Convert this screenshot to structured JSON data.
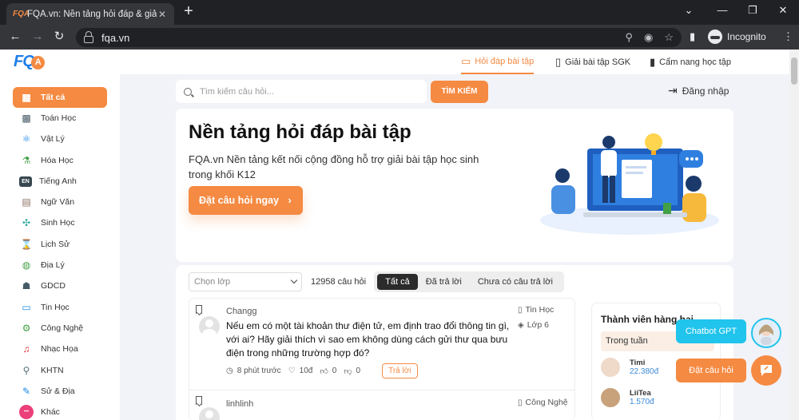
{
  "browser": {
    "tab_title": "FQA.vn: Nền tảng hỏi đáp & giải bà",
    "tab_favicon": "FQA",
    "url": "fqa.vn",
    "profile_label": "Incognito"
  },
  "site": {
    "logo_letters": "FQ",
    "logo_badge": "A",
    "nav": [
      {
        "label": "Hỏi đáp bài tập",
        "icon": "chat-icon"
      },
      {
        "label": "Giải bài tập SGK",
        "icon": "book-icon"
      },
      {
        "label": "Cẩm nang học tập",
        "icon": "notebook-icon"
      }
    ],
    "login_label": "Đăng nhập"
  },
  "sidebar": {
    "items": [
      {
        "label": "Tất cả",
        "icon": "grid-icon",
        "glyph": "▦"
      },
      {
        "label": "Toán Học",
        "icon": "calculator-icon",
        "glyph": "▩"
      },
      {
        "label": "Vật Lý",
        "icon": "atom-icon",
        "glyph": "⚛"
      },
      {
        "label": "Hóa Học",
        "icon": "flask-icon",
        "glyph": "⚗"
      },
      {
        "label": "Tiếng Anh",
        "icon": "en-icon",
        "glyph": "EN"
      },
      {
        "label": "Ngữ Văn",
        "icon": "book-icon",
        "glyph": "▤"
      },
      {
        "label": "Sinh Học",
        "icon": "dna-icon",
        "glyph": "✣"
      },
      {
        "label": "Lịch Sử",
        "icon": "hourglass-icon",
        "glyph": "⌛"
      },
      {
        "label": "Địa Lý",
        "icon": "globe-icon",
        "glyph": "◍"
      },
      {
        "label": "GDCD",
        "icon": "person-icon",
        "glyph": "☗"
      },
      {
        "label": "Tin Học",
        "icon": "computer-icon",
        "glyph": "▭"
      },
      {
        "label": "Công Nghệ",
        "icon": "gear-icon",
        "glyph": "⚙"
      },
      {
        "label": "Nhạc Họa",
        "icon": "music-icon",
        "glyph": "♫"
      },
      {
        "label": "KHTN",
        "icon": "microscope-icon",
        "glyph": "⚲"
      },
      {
        "label": "Sử & Địa",
        "icon": "map-icon",
        "glyph": "✎"
      },
      {
        "label": "Khác",
        "icon": "more-icon",
        "glyph": "•••"
      }
    ]
  },
  "search": {
    "placeholder": "Tìm kiếm câu hỏi...",
    "button_label": "TÌM KIẾM"
  },
  "hero": {
    "title": "Nền tảng hỏi đáp bài tập",
    "subtitle": "FQA.vn Nền tảng kết nối cộng đồng hỗ trợ giải bài tập học sinh trong khối K12",
    "cta_label": "Đặt câu hỏi ngay",
    "cta_arrow": "›"
  },
  "filters": {
    "grade_placeholder": "Chọn lớp",
    "question_count": "12958 câu hỏi",
    "segments": [
      "Tất cả",
      "Đã trả lời",
      "Chưa có câu trả lời"
    ],
    "active_segment": 0
  },
  "questions": [
    {
      "user": "Changg",
      "subject": "Tin Học",
      "grade": "Lớp 6",
      "text": "Nếu em có một tài khoản thư điện tử, em định trao đổi thông tin gì, với ai? Hãy giải thích vì sao em không dùng cách gửi thư qua bưu điện trong những trường hợp đó?",
      "time": "8 phút trước",
      "points": "10đ",
      "likes": "0",
      "dislikes": "0",
      "reply_label": "Trả lời"
    },
    {
      "user": "linhlinh",
      "subject": "Công Nghệ"
    }
  ],
  "ranking": {
    "title": "Thành viên hàng hai",
    "period": "Trong tuần",
    "members": [
      {
        "name": "Timi",
        "points": "22.380đ"
      },
      {
        "name": "LiiTea",
        "points": "1.570đ"
      }
    ]
  },
  "floating": {
    "chatbot_label": "Chatbot GPT",
    "ask_label": "Đặt câu hỏi"
  },
  "colors": {
    "accent": "#f58a42",
    "chatbot": "#20c4ec",
    "brand_blue": "#1f7ee8"
  }
}
